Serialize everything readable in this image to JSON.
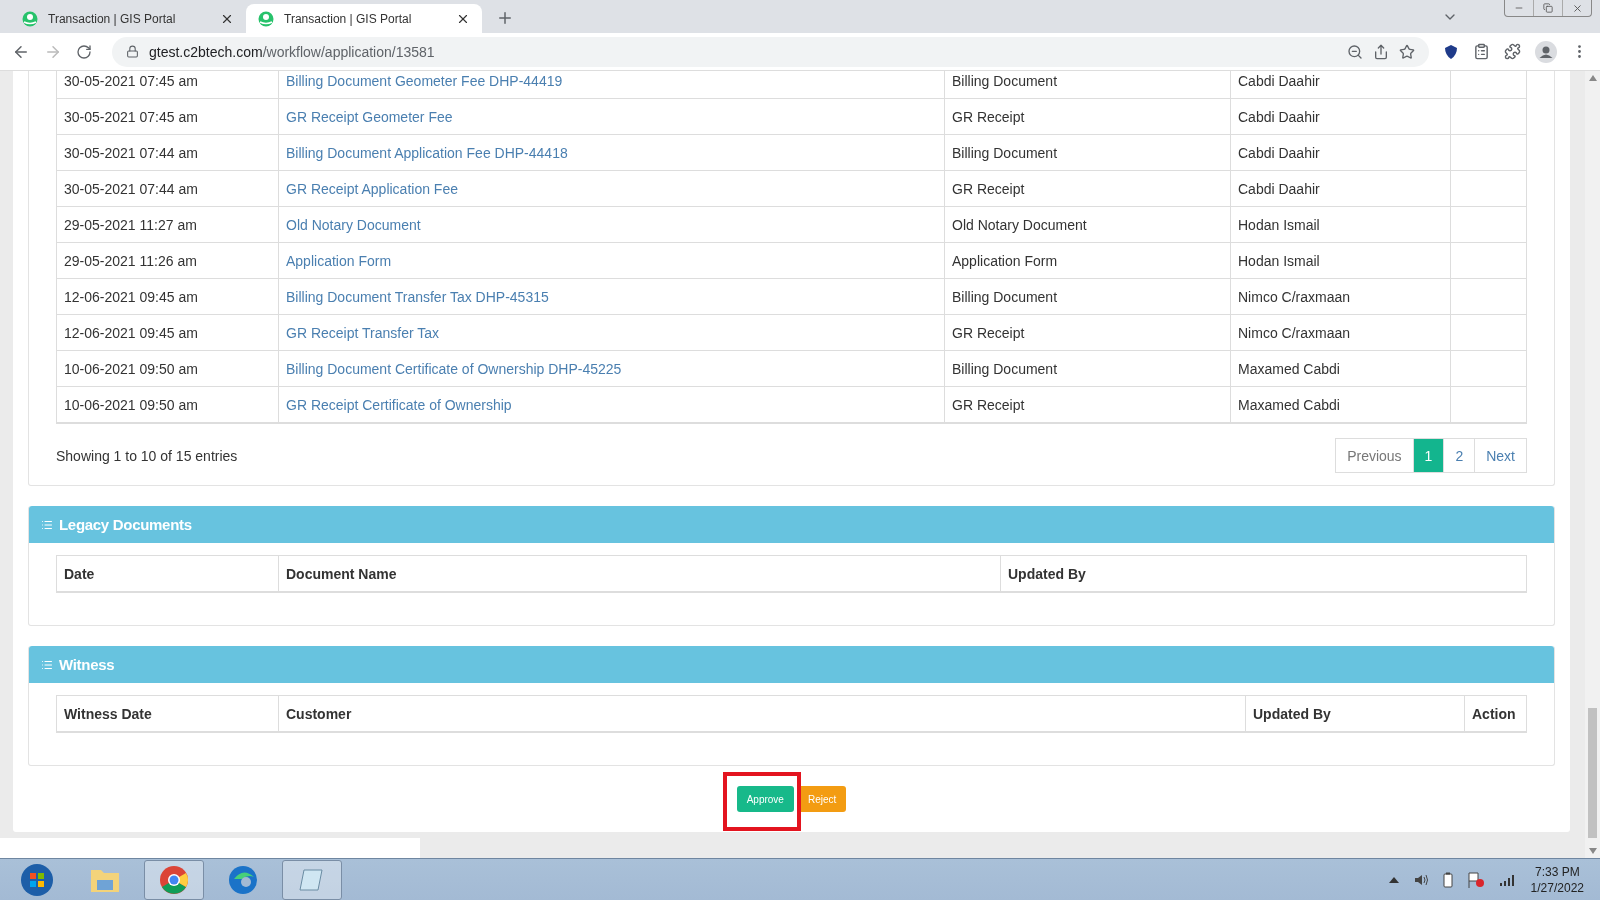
{
  "browser": {
    "tabs": [
      {
        "title": "Transaction | GIS Portal",
        "selected": false
      },
      {
        "title": "Transaction | GIS Portal",
        "selected": true
      }
    ],
    "url_host": "gtest.c2btech.com",
    "url_path": "/workflow/application/13581"
  },
  "transactions": {
    "rows": [
      {
        "date": "30-05-2021 07:45 am",
        "document": "Billing Document Geometer Fee DHP-44419",
        "type": "Billing Document",
        "updated_by": "Cabdi Daahir"
      },
      {
        "date": "30-05-2021 07:45 am",
        "document": "GR Receipt Geometer Fee",
        "type": "GR Receipt",
        "updated_by": "Cabdi Daahir"
      },
      {
        "date": "30-05-2021 07:44 am",
        "document": "Billing Document Application Fee DHP-44418",
        "type": "Billing Document",
        "updated_by": "Cabdi Daahir"
      },
      {
        "date": "30-05-2021 07:44 am",
        "document": "GR Receipt Application Fee",
        "type": "GR Receipt",
        "updated_by": "Cabdi Daahir"
      },
      {
        "date": "29-05-2021 11:27 am",
        "document": "Old Notary Document",
        "type": "Old Notary Document",
        "updated_by": "Hodan Ismail"
      },
      {
        "date": "29-05-2021 11:26 am",
        "document": "Application Form",
        "type": "Application Form",
        "updated_by": "Hodan Ismail"
      },
      {
        "date": "12-06-2021 09:45 am",
        "document": "Billing Document Transfer Tax DHP-45315",
        "type": "Billing Document",
        "updated_by": "Nimco C/raxmaan"
      },
      {
        "date": "12-06-2021 09:45 am",
        "document": "GR Receipt Transfer Tax",
        "type": "GR Receipt",
        "updated_by": "Nimco C/raxmaan"
      },
      {
        "date": "10-06-2021 09:50 am",
        "document": "Billing Document Certificate of Ownership DHP-45225",
        "type": "Billing Document",
        "updated_by": "Maxamed Cabdi"
      },
      {
        "date": "10-06-2021 09:50 am",
        "document": "GR Receipt Certificate of Ownership",
        "type": "GR Receipt",
        "updated_by": "Maxamed Cabdi"
      }
    ],
    "info": "Showing 1 to 10 of 15 entries",
    "pagination": {
      "previous": "Previous",
      "pages": [
        {
          "label": "1",
          "selected": true
        },
        {
          "label": "2",
          "selected": false
        }
      ],
      "next": "Next"
    }
  },
  "panels": [
    {
      "title": "Legacy Documents",
      "columns": [
        "Date",
        "Document Name",
        "Updated By"
      ]
    },
    {
      "title": "Witness",
      "columns": [
        "Witness Date",
        "Customer",
        "Updated By",
        "Action"
      ]
    }
  ],
  "buttons": [
    {
      "label": "Approve",
      "kind": "approve",
      "highlighted": true
    },
    {
      "label": "Reject",
      "kind": "reject",
      "highlighted": false
    }
  ],
  "taskbar": {
    "time": "7:33 PM",
    "date": "1/27/2022"
  }
}
